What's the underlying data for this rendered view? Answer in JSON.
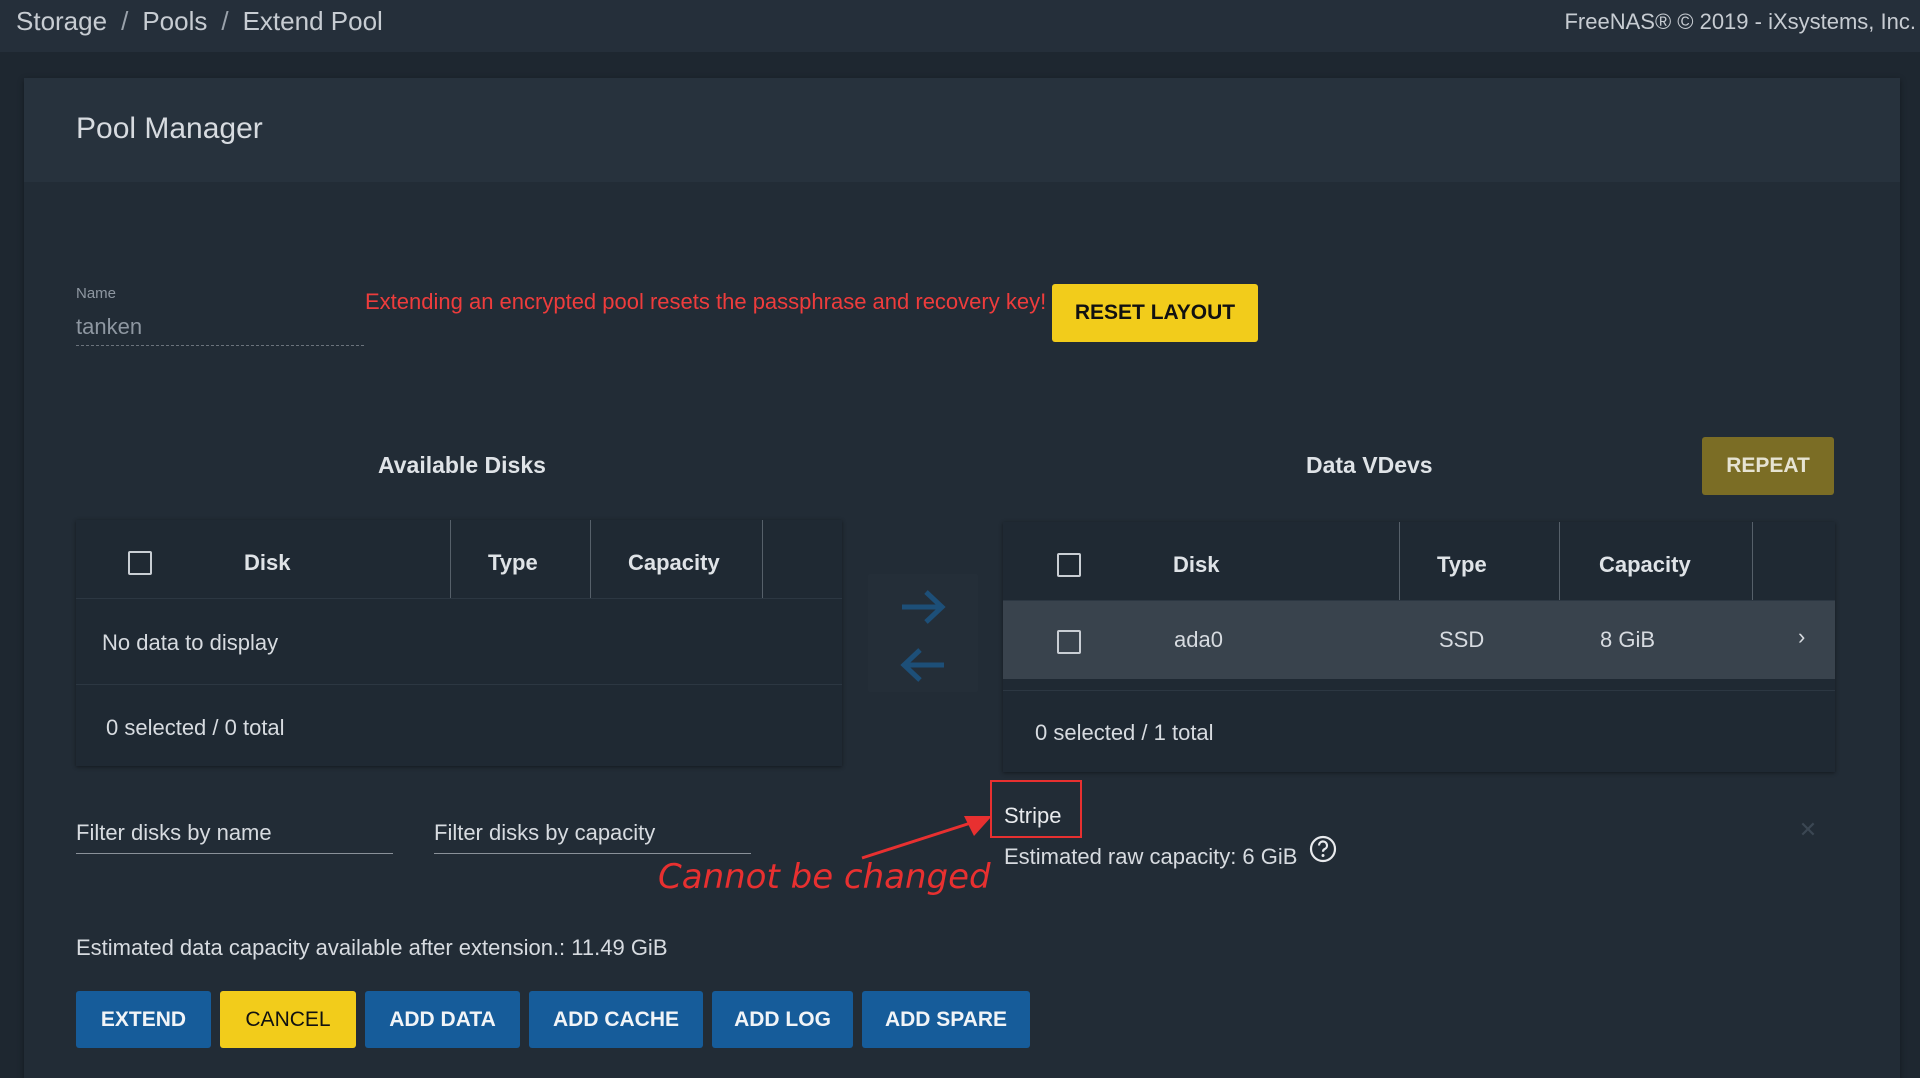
{
  "breadcrumb": {
    "items": [
      "Storage",
      "Pools",
      "Extend Pool"
    ]
  },
  "copyright": "FreeNAS® © 2019 - iXsystems, Inc.",
  "card": {
    "title": "Pool Manager"
  },
  "name_field": {
    "label": "Name",
    "value": "tanken"
  },
  "warning": "Extending an encrypted pool resets the passphrase and recovery key!",
  "buttons": {
    "reset_layout": "RESET LAYOUT",
    "repeat": "REPEAT",
    "extend": "EXTEND",
    "cancel": "CANCEL",
    "add_data": "ADD DATA",
    "add_cache": "ADD CACHE",
    "add_log": "ADD LOG",
    "add_spare": "ADD SPARE"
  },
  "available_disks": {
    "title": "Available Disks",
    "columns": [
      "Disk",
      "Type",
      "Capacity"
    ],
    "empty_message": "No data to display",
    "footer": "0 selected / 0 total"
  },
  "data_vdevs": {
    "title": "Data VDevs",
    "columns": [
      "Disk",
      "Type",
      "Capacity"
    ],
    "rows": [
      {
        "disk": "ada0",
        "type": "SSD",
        "capacity": "8 GiB"
      }
    ],
    "footer": "0 selected / 1 total",
    "layout": "Stripe",
    "raw_capacity": "Estimated raw capacity: 6 GiB"
  },
  "filters": {
    "by_name": "Filter disks by name",
    "by_capacity": "Filter disks by capacity"
  },
  "annotation": "Cannot be changed",
  "estimated_capacity": "Estimated data capacity available after extension.: 11.49 GiB",
  "icons": {
    "move_right": "arrow-right-icon",
    "move_left": "arrow-left-icon",
    "help": "help-circle-icon",
    "row_expand": "chevron-right-icon",
    "remove_vdev": "close-icon"
  },
  "colors": {
    "background": "#1e2730",
    "primary": "#165c9a",
    "accent": "#f2cc1b",
    "warning": "#ee3c3c",
    "annotation": "#e83030"
  }
}
